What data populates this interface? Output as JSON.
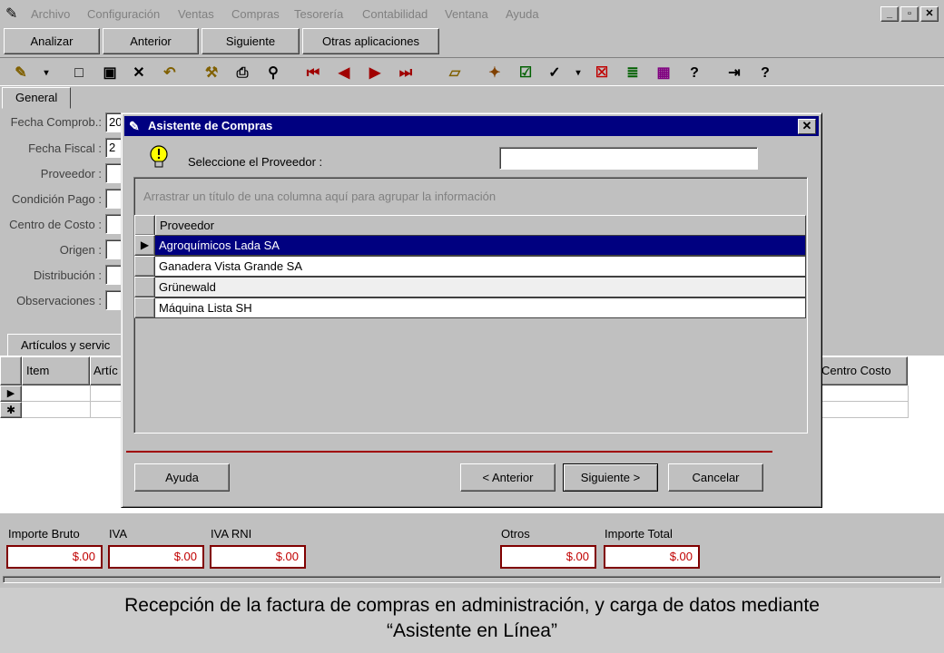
{
  "menu": {
    "items": [
      "Archivo",
      "Configuración",
      "Ventas",
      "Compras",
      "Tesorería",
      "Contabilidad",
      "Ventana",
      "Ayuda"
    ],
    "window_buttons": [
      "_",
      "▫",
      "✕"
    ]
  },
  "nav": {
    "analizar": "Analizar",
    "anterior": "Anterior",
    "siguiente": "Siguiente",
    "otras": "Otras aplicaciones"
  },
  "tabs": {
    "general": "General"
  },
  "form": {
    "fecha_comprob_label": "Fecha Comprob.:",
    "fecha_comprob_value": "20",
    "fecha_fiscal_label": "Fecha Fiscal :",
    "fecha_fiscal_value": "2",
    "proveedor_label": "Proveedor :",
    "condicion_label": "Condición Pago :",
    "centro_label": "Centro de Costo :",
    "origen_label": "Origen :",
    "distribucion_label": "Distribución :",
    "observaciones_label": "Observaciones :"
  },
  "items_section": {
    "tab_label": "Artículos y servic",
    "columns": [
      "Item",
      "Artíc",
      "Centro Costo"
    ],
    "new_row_marker": "✱"
  },
  "totals": {
    "importe_bruto": {
      "label": "Importe Bruto",
      "value": "$.00"
    },
    "iva": {
      "label": "IVA",
      "value": "$.00"
    },
    "iva_rni": {
      "label": "IVA RNI",
      "value": "$.00"
    },
    "otros": {
      "label": "Otros",
      "value": "$.00"
    },
    "importe_total": {
      "label": "Importe Total",
      "value": "$.00"
    }
  },
  "dialog": {
    "title": "Asistente de Compras",
    "close": "✕",
    "prompt": "Seleccione el Proveedor :",
    "search_value": "",
    "group_hint": "Arrastrar un título de una columna aquí para agrupar la información",
    "column_header": "Proveedor",
    "rows": [
      "Agroquímicos Lada SA",
      "Ganadera Vista Grande SA",
      "Grünewald",
      "Máquina Lista SH"
    ],
    "buttons": {
      "ayuda": "Ayuda",
      "anterior": "< Anterior",
      "siguiente": "Siguiente >",
      "cancelar": "Cancelar"
    }
  },
  "caption": {
    "line1": "Recepción de la factura de compras en administración, y carga de datos mediante",
    "line2": "“Asistente en Línea”"
  }
}
